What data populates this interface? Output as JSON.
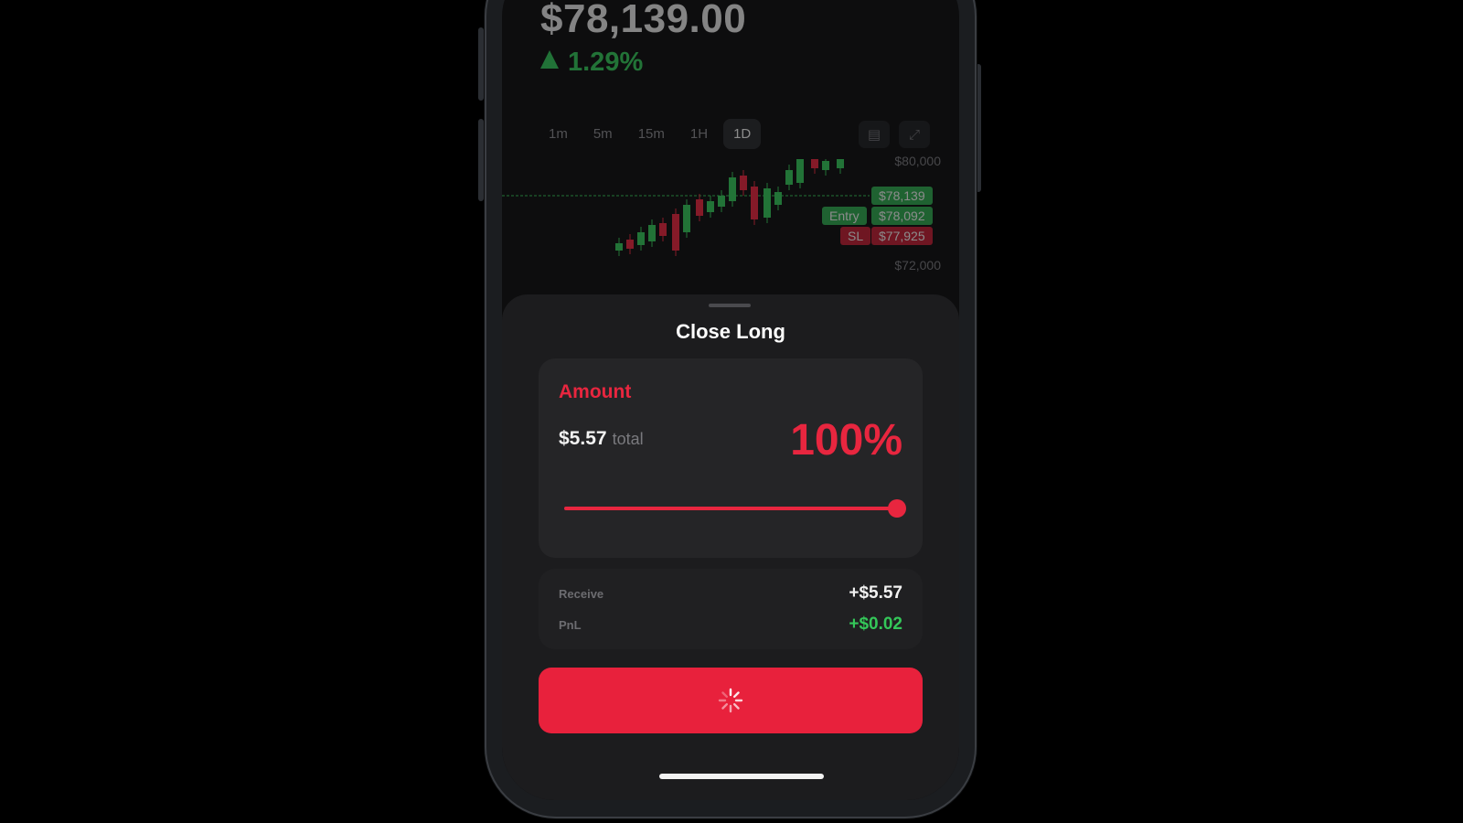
{
  "header": {
    "price": "$78,139.00",
    "change": "1.29%",
    "change_icon": "triangle-up-icon"
  },
  "timeframes": [
    {
      "label": "1m",
      "active": false
    },
    {
      "label": "5m",
      "active": false
    },
    {
      "label": "15m",
      "active": false
    },
    {
      "label": "1H",
      "active": false
    },
    {
      "label": "1D",
      "active": true
    }
  ],
  "chart_tools": {
    "chart_type_icon": "chart-type-icon",
    "expand_icon": "expand-icon"
  },
  "chart": {
    "axis_top": "$80,000",
    "axis_bottom": "$72,000",
    "price_tag": "$78,139",
    "entry_label": "Entry",
    "entry_price": "$78,092",
    "sl_label": "SL",
    "sl_price": "$77,925",
    "up_color": "#34c759",
    "down_color": "#e8263f"
  },
  "sheet": {
    "title": "Close Long",
    "amount_label": "Amount",
    "total_value": "$5.57",
    "total_suffix": "total",
    "percent_label": "100%",
    "slider_fraction": 1.0,
    "receive_label": "Receive",
    "receive_value": "+$5.57",
    "pnl_label": "PnL",
    "pnl_value": "+$0.02",
    "button_state": "loading",
    "button_icon": "spinner-icon"
  },
  "colors": {
    "accent_red": "#e8213c",
    "positive_green": "#34c759"
  }
}
